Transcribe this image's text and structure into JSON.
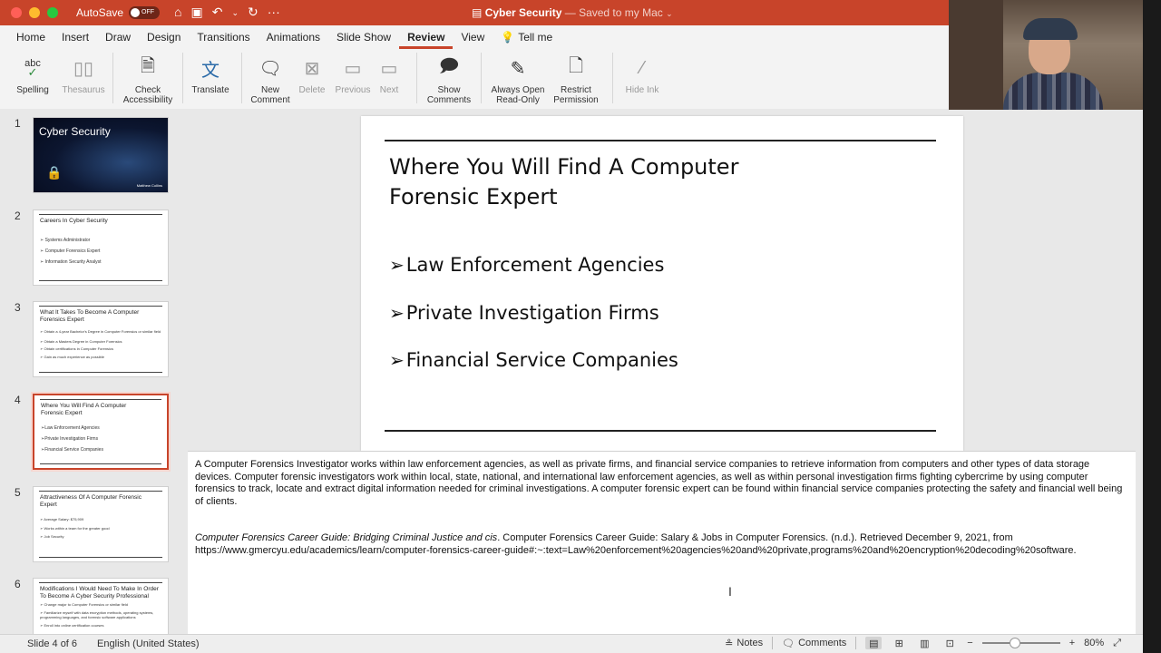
{
  "titlebar": {
    "autosave_label": "AutoSave",
    "autosave_state": "OFF",
    "doc_name": "Cyber Security",
    "doc_status": "— Saved to my Mac"
  },
  "tabs": [
    {
      "label": "Home"
    },
    {
      "label": "Insert"
    },
    {
      "label": "Draw"
    },
    {
      "label": "Design"
    },
    {
      "label": "Transitions"
    },
    {
      "label": "Animations"
    },
    {
      "label": "Slide Show"
    },
    {
      "label": "Review"
    },
    {
      "label": "View"
    },
    {
      "label": "Tell me"
    }
  ],
  "ribbon": {
    "spelling": "Spelling",
    "thesaurus": "Thesaurus",
    "check_accessibility": "Check\nAccessibility",
    "translate": "Translate",
    "new_comment": "New\nComment",
    "delete": "Delete",
    "previous": "Previous",
    "next": "Next",
    "show_comments": "Show\nComments",
    "always_open_read_only": "Always Open\nRead-Only",
    "restrict_permission": "Restrict\nPermission",
    "hide_ink": "Hide Ink",
    "spelling_icon_text": "abc"
  },
  "thumbs": [
    {
      "num": "1",
      "title": "Cyber Security",
      "author": "Matthew Collins"
    },
    {
      "num": "2",
      "title": "Careers In Cyber Security",
      "bullets": [
        "➢ Systems Administrator",
        "➢ Computer Forensics Expert",
        "➢ Information Security Analyst"
      ]
    },
    {
      "num": "3",
      "title": "What It Takes To Become A Computer Forensics Expert",
      "bullets": [
        "➢ Obtain a 4-year Bachelor's Degree in Computer Forensics or similar field",
        "➢ Obtain a Masters Degree in Computer Forensics",
        "➢ Obtain certifications in Computer Forensics",
        "➢ Gain as much experience as possible"
      ]
    },
    {
      "num": "4",
      "title": "Where You Will Find A Computer Forensic Expert",
      "bullets": [
        "➢Law Enforcement Agencies",
        "➢Private Investigation Firms",
        "➢Financial Service Companies"
      ]
    },
    {
      "num": "5",
      "title": "Attractiveness Of A Computer Forensic Expert",
      "bullets": [
        "➢ Average Salary: $75,909",
        "➢ Works within a team for the greater good",
        "➢ Job Security"
      ]
    },
    {
      "num": "6",
      "title": "Modifications I Would Need To Make In Order To Become A Cyber Security Professional",
      "bullets": [
        "➢ Change major to Computer Forensics or similar field",
        "➢ Familiarize myself with data encryption methods, operating systems,",
        "   programming languages, and forensic software applications",
        "➢ Enroll into online certification courses"
      ]
    }
  ],
  "slide": {
    "title": "Where You Will Find A Computer Forensic Expert",
    "bullets": [
      "Law Enforcement Agencies",
      "Private Investigation Firms",
      "Financial Service Companies"
    ]
  },
  "notes": {
    "paragraph": "A Computer Forensics Investigator works within law enforcement agencies, as well as private firms, and financial service companies to retrieve information from computers and other types of data storage devices. Computer forensic investigators work within local, state, national, and international law enforcement agencies, as well as within personal investigation firms fighting cybercrime by using computer forensics to track, locate and extract digital information needed for criminal investigations. A computer forensic expert can be found within financial service companies protecting the safety and financial well being of clients.",
    "citation_italic": "Computer Forensics Career Guide: Bridging Criminal Justice and cis",
    "citation_rest": ". Computer Forensics Career Guide: Salary & Jobs in Computer Forensics. (n.d.). Retrieved December 9, 2021, from https://www.gmercyu.edu/academics/learn/computer-forensics-career-guide#:~:text=Law%20enforcement%20agencies%20and%20private,programs%20and%20encryption%20decoding%20software."
  },
  "status": {
    "slide_indicator": "Slide 4 of 6",
    "language": "English (United States)",
    "notes_label": "Notes",
    "comments_label": "Comments",
    "zoom": "80%",
    "zoom_level_percent": 80
  },
  "colors": {
    "accent": "#c8442a",
    "titlebar": "#c8442a"
  }
}
